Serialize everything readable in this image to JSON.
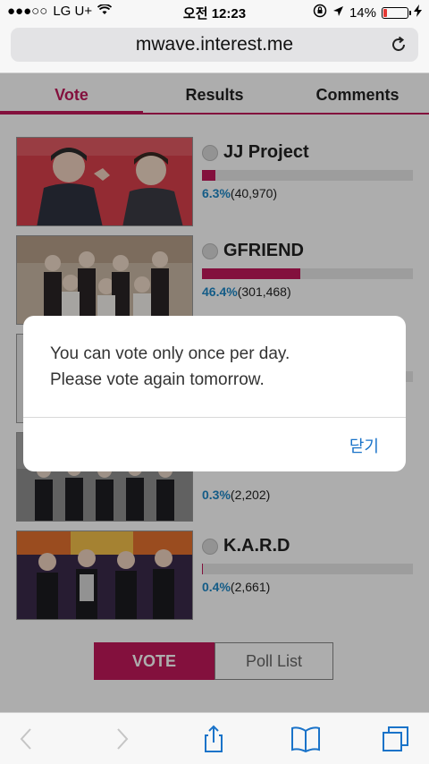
{
  "status_bar": {
    "carrier": "LG U+",
    "time": "오전 12:23",
    "battery": "14%",
    "battery_level": 0.14
  },
  "browser": {
    "url": "mwave.interest.me"
  },
  "tabs": [
    {
      "label": "Vote",
      "active": true
    },
    {
      "label": "Results",
      "active": false
    },
    {
      "label": "Comments",
      "active": false
    }
  ],
  "candidates": [
    {
      "name": "JJ Project",
      "percent": "6.3%",
      "votes": "(40,970)",
      "level": 0.063
    },
    {
      "name": "GFRIEND",
      "percent": "46.4%",
      "votes": "(301,468)",
      "level": 0.464
    },
    {
      "name": "",
      "percent": "",
      "votes": "",
      "level": 0
    },
    {
      "name": "",
      "percent": "0.3%",
      "votes": "(2,202)",
      "level": 0.003
    },
    {
      "name": "K.A.R.D",
      "percent": "0.4%",
      "votes": "(2,661)",
      "level": 0.004
    }
  ],
  "buttons": {
    "vote": "VOTE",
    "poll_list": "Poll List"
  },
  "dialog": {
    "line1": "You can vote only once per day.",
    "line2": "Please vote again tomorrow.",
    "close": "닫기"
  },
  "colors": {
    "accent": "#c2185b",
    "percent": "#1e88c7",
    "ios_blue": "#1a73c9"
  }
}
